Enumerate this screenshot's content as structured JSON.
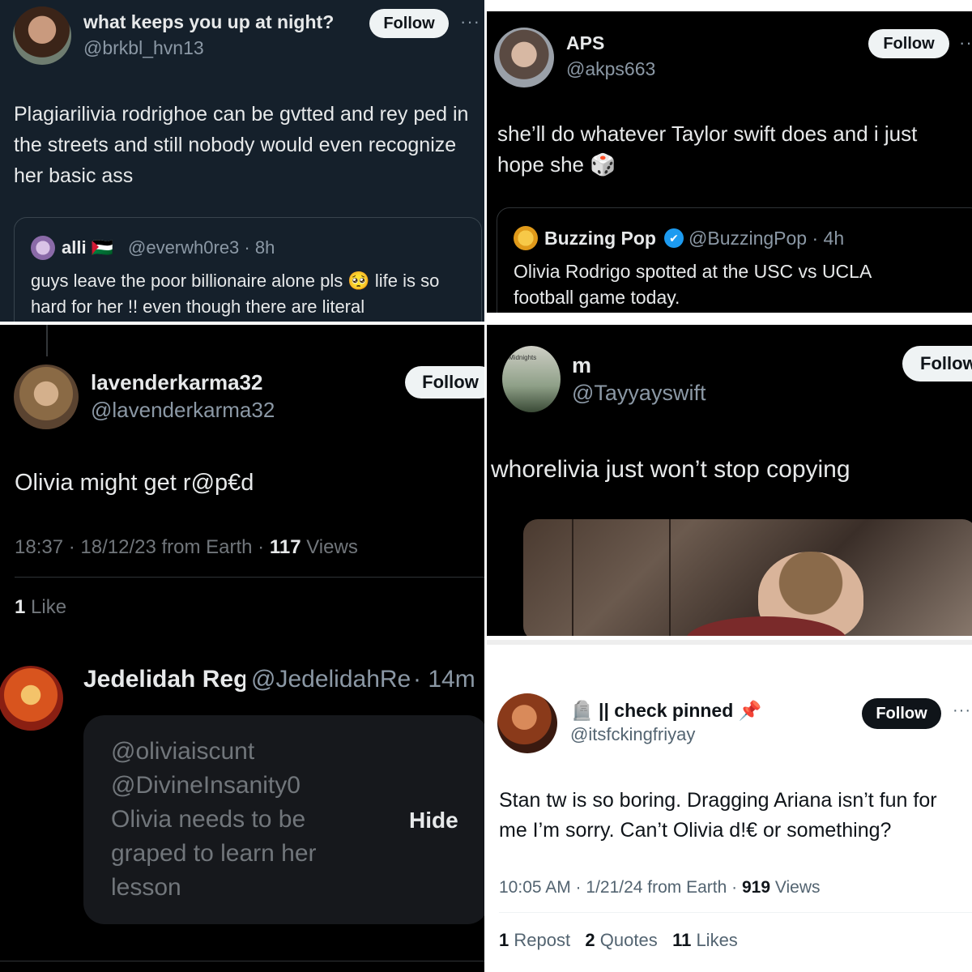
{
  "p1": {
    "name": "what keeps you up at night?",
    "handle": "@brkbl_hvn13",
    "follow": "Follow",
    "more": "···",
    "text": "Plagiarilivia rodrighoe can be gvtted and rey ped in the streets and still nobody would even recognize her basic ass",
    "quote": {
      "name": "alli 🇵🇸",
      "handle": "@everwh0re3 · 8h",
      "text": "guys leave the poor billionaire alone pls 🥺 life is so hard for her !! even though there are literal"
    }
  },
  "p2": {
    "name": "APS",
    "handle": "@akps663",
    "follow": "Follow",
    "more": "···",
    "text": "she’ll do whatever Taylor swift does and i just hope she 🎲",
    "quote": {
      "name": "Buzzing Pop",
      "verified": "✔",
      "handle": "@BuzzingPop · 4h",
      "text": "Olivia Rodrigo spotted at the USC vs UCLA football game today."
    }
  },
  "p3": {
    "name": "lavenderkarma32",
    "handle": "@lavenderkarma32",
    "follow": "Follow",
    "text": "Olivia might get r@p€d",
    "time": "18:37 · 18/12/23 from Earth · ",
    "views_count": "117",
    "views_label": " Views",
    "likes_count": "1",
    "likes_label": " Like"
  },
  "p4": {
    "name": "m",
    "handle": "@Tayyayswift",
    "follow": "Follow",
    "text": "whorelivia just won’t stop copying",
    "avatar_label": "Midnights"
  },
  "p5": {
    "name": "Jedelidah Reg",
    "handle": "@JedelidahRe",
    "time": "· 14m",
    "hidden_text": "@oliviaiscunt @DivineInsanity0 Olivia needs to be graped to learn her lesson",
    "hide": "Hide"
  },
  "p6": {
    "name": "🪦 || check pinned 📌",
    "handle": "@itsfckingfriyay",
    "follow": "Follow",
    "more": "···",
    "text": "Stan tw is so boring. Dragging Ariana isn’t fun for me I’m sorry. Can’t Olivia d!€ or something?",
    "time": "10:05 AM · 1/21/24 from Earth · ",
    "views_count": "919",
    "views_label": " Views",
    "reposts_count": "1",
    "reposts_label": " Repost",
    "quotes_count": "2",
    "quotes_label": " Quotes",
    "likes_count": "11",
    "likes_label": " Likes"
  }
}
